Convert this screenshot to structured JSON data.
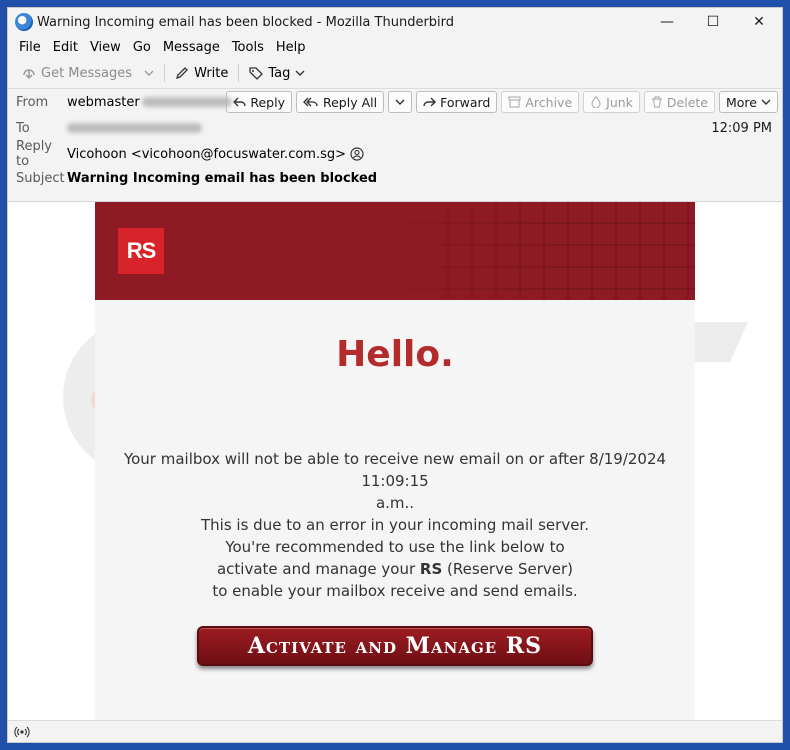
{
  "window": {
    "title": "Warning Incoming email has been blocked - Mozilla Thunderbird",
    "minimize_glyph": "—",
    "maximize_glyph": "☐",
    "close_glyph": "✕"
  },
  "menu": [
    "File",
    "Edit",
    "View",
    "Go",
    "Message",
    "Tools",
    "Help"
  ],
  "toolbar": {
    "get_messages": "Get Messages",
    "write": "Write",
    "tag": "Tag"
  },
  "header": {
    "from_label": "From",
    "from_value": "webmaster",
    "to_label": "To",
    "reply_to_label": "Reply to",
    "reply_to_value": "Vicohoon <vicohoon@focuswater.com.sg>",
    "subject_label": "Subject",
    "subject_value": "Warning Incoming email has been blocked",
    "time": "12:09 PM",
    "actions": {
      "reply": "Reply",
      "reply_all": "Reply All",
      "forward": "Forward",
      "archive": "Archive",
      "junk": "Junk",
      "delete": "Delete",
      "more": "More"
    }
  },
  "email": {
    "logo_text": "RS",
    "greeting": "Hello.",
    "line1": "Your mailbox will not be able to receive new email on or after 8/19/2024 11:09:15",
    "line2": "a.m..",
    "line3": "This is due to an error in your incoming mail server.",
    "line4": "You're recommended to use the link below to",
    "line5_pre": "activate and manage your ",
    "line5_bold": "RS",
    "line5_post": " (Reserve Server)",
    "line6": "to enable your mailbox receive and send emails.",
    "cta": "Activate and Manage RS"
  },
  "colors": {
    "accent_red": "#b42b2b",
    "banner_red": "#8e1a24",
    "logo_red": "#d8232a",
    "desktop_blue": "#1f4fa8"
  },
  "icons": [
    "thunderbird-icon",
    "get-messages-icon",
    "write-icon",
    "tag-icon",
    "reply-icon",
    "reply-all-icon",
    "forward-icon",
    "archive-icon",
    "junk-icon",
    "delete-icon",
    "contact-icon",
    "connection-icon"
  ]
}
